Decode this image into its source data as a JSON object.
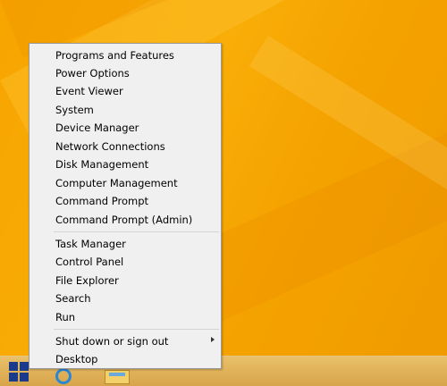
{
  "menu": {
    "group1": [
      {
        "label": "Programs and Features"
      },
      {
        "label": "Power Options"
      },
      {
        "label": "Event Viewer"
      },
      {
        "label": "System"
      },
      {
        "label": "Device Manager"
      },
      {
        "label": "Network Connections"
      },
      {
        "label": "Disk Management"
      },
      {
        "label": "Computer Management"
      },
      {
        "label": "Command Prompt"
      },
      {
        "label": "Command Prompt (Admin)"
      }
    ],
    "group2": [
      {
        "label": "Task Manager"
      },
      {
        "label": "Control Panel"
      },
      {
        "label": "File Explorer"
      },
      {
        "label": "Search"
      },
      {
        "label": "Run"
      }
    ],
    "group3": [
      {
        "label": "Shut down or sign out",
        "submenu": true
      },
      {
        "label": "Desktop"
      }
    ]
  },
  "taskbar": {
    "start_icon": "windows-logo-icon",
    "pinned": [
      "internet-explorer-icon",
      "file-explorer-icon"
    ]
  },
  "colors": {
    "desktop": "#f7a500",
    "menu_bg": "#f0f0f0",
    "menu_border": "#9a9a9a"
  }
}
